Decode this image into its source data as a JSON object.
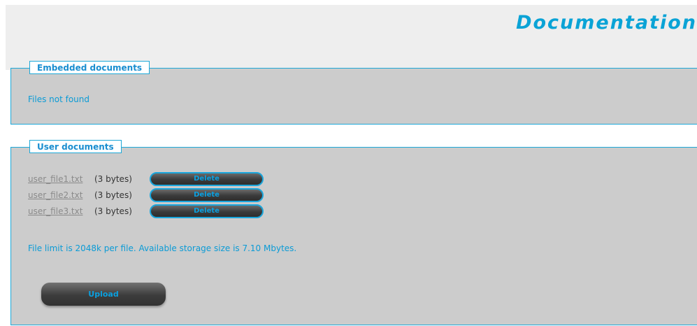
{
  "header": {
    "title": "Documentation"
  },
  "embedded": {
    "legend": "Embedded documents",
    "status": "Files not found"
  },
  "user_documents": {
    "legend": "User documents",
    "files": [
      {
        "name": "user_file1.txt",
        "size": "(3 bytes)",
        "delete_label": "Delete"
      },
      {
        "name": "user_file2.txt",
        "size": "(3 bytes)",
        "delete_label": "Delete"
      },
      {
        "name": "user_file3.txt",
        "size": "(3 bytes)",
        "delete_label": "Delete"
      }
    ],
    "limit_text": "File limit is 2048k per file. Available storage size is 7.10 Mbytes.",
    "upload_label": "Upload"
  },
  "colors": {
    "accent": "#0aa3d6",
    "panel_background": "#cccccc",
    "header_background": "#eeeeee",
    "button_dark": "#3a3a3a"
  }
}
